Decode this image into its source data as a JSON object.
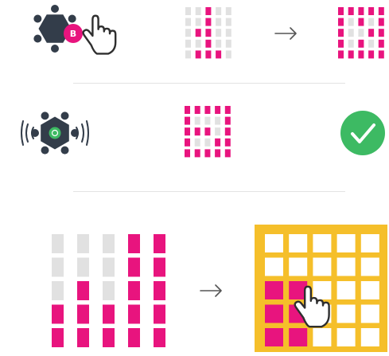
{
  "colors": {
    "pink": "#e8147e",
    "gray": "#e1e1e1",
    "device": "#333d4a",
    "yellow": "#f5bf2a",
    "green": "#3dba63",
    "arrow": "#555555"
  },
  "steps": [
    {
      "device_button_label": "B",
      "before_grid": [
        [
          0,
          0,
          1,
          0,
          0
        ],
        [
          0,
          0,
          1,
          0,
          0
        ],
        [
          0,
          1,
          1,
          0,
          0
        ],
        [
          0,
          0,
          1,
          0,
          0
        ],
        [
          0,
          1,
          1,
          1,
          0
        ]
      ],
      "after_grid": [
        [
          1,
          1,
          1,
          1,
          1
        ],
        [
          1,
          0,
          1,
          0,
          1
        ],
        [
          1,
          0,
          0,
          1,
          1
        ],
        [
          1,
          0,
          1,
          0,
          1
        ],
        [
          1,
          1,
          1,
          1,
          1
        ]
      ],
      "icons": [
        "sensor-hub-icon",
        "hand-pointer-icon",
        "arrow-right-icon"
      ]
    },
    {
      "grid": [
        [
          1,
          1,
          1,
          1,
          1
        ],
        [
          1,
          0,
          0,
          0,
          1
        ],
        [
          1,
          1,
          1,
          0,
          1
        ],
        [
          1,
          0,
          0,
          1,
          1
        ],
        [
          1,
          1,
          1,
          1,
          1
        ]
      ],
      "icons": [
        "shaking-sensor-hub-icon",
        "checkmark-icon"
      ]
    },
    {
      "levels": [
        2,
        3,
        2,
        5,
        5
      ],
      "level_max": 5,
      "yellow_grid": [
        [
          0,
          0,
          0,
          0,
          0
        ],
        [
          0,
          0,
          0,
          0,
          0
        ],
        [
          1,
          1,
          0,
          0,
          0
        ],
        [
          1,
          1,
          0,
          0,
          0
        ],
        [
          1,
          1,
          0,
          0,
          0
        ]
      ],
      "icons": [
        "arrow-right-icon",
        "hand-pointer-icon"
      ]
    }
  ]
}
